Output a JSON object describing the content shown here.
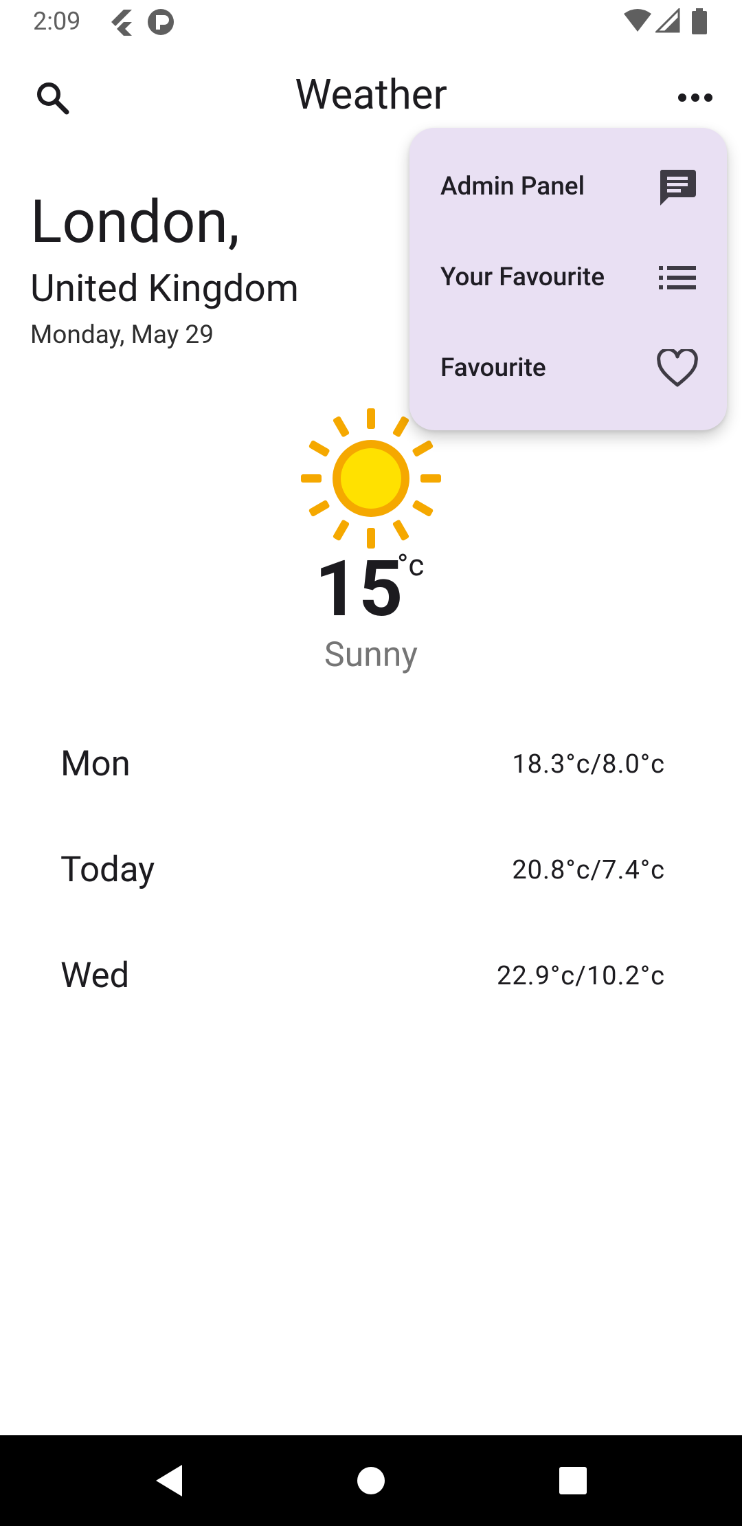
{
  "status_bar": {
    "time": "2:09"
  },
  "app_bar": {
    "title": "Weather",
    "search_icon": "search-icon",
    "more_icon": "more-horiz-icon"
  },
  "location": {
    "city": "London,",
    "country": "United Kingdom",
    "date": "Monday, May 29"
  },
  "current": {
    "icon": "sun-icon",
    "temperature": "15",
    "unit": "°c",
    "condition": "Sunny"
  },
  "forecast": [
    {
      "day": "Mon",
      "range": "18.3°c/8.0°c"
    },
    {
      "day": "Today",
      "range": "20.8°c/7.4°c"
    },
    {
      "day": "Wed",
      "range": "22.9°c/10.2°c"
    }
  ],
  "menu": {
    "items": [
      {
        "label": "Admin Panel",
        "icon": "chat-icon"
      },
      {
        "label": "Your Favourite",
        "icon": "list-icon"
      },
      {
        "label": "Favourite",
        "icon": "heart-icon"
      }
    ]
  },
  "colors": {
    "menu_background": "#e9e0f3",
    "sun": "#f5a800",
    "sun_core": "#ffe100"
  }
}
